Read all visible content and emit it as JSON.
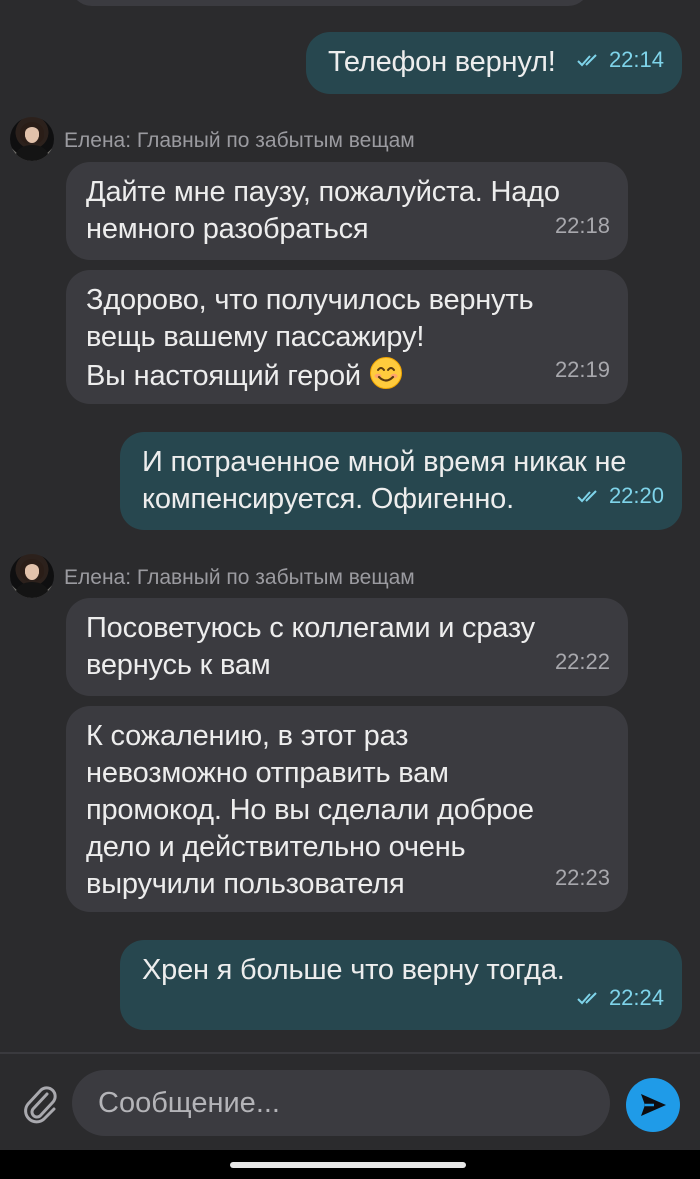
{
  "messages": [
    {
      "dir": "out",
      "text": "Телефон вернул!",
      "time": "22:14"
    },
    {
      "dir": "in",
      "sender": "Елена: Главный по забытым вещам",
      "text": "Дайте мне паузу, пожалуйста. Надо\nнемного разобраться",
      "time": "22:18"
    },
    {
      "dir": "in",
      "text": "Здорово, что получилось вернуть\nвещь вашему пассажиру!\nВы настоящий герой",
      "emoji": "smiling-face-icon",
      "time": "22:19"
    },
    {
      "dir": "out",
      "text": "И потраченное мной время никак не\nкомпенсируется. Офигенно.",
      "time": "22:20"
    },
    {
      "dir": "in",
      "sender": "Елена: Главный по забытым вещам",
      "text": "Посоветуюсь с коллегами и сразу\nвернусь к вам",
      "time": "22:22"
    },
    {
      "dir": "in",
      "text": "К сожалению, в этот раз\nневозможно отправить вам\nпромокод. Но вы сделали доброе\nдело и действительно очень\nвыручили пользователя",
      "time": "22:23"
    },
    {
      "dir": "out",
      "text": "Хрен я больше что верну тогда.",
      "time": "22:24"
    }
  ],
  "composer": {
    "placeholder": "Сообщение...",
    "attach_icon": "paperclip-icon",
    "send_icon": "send-icon"
  },
  "colors": {
    "background": "#2b2b2d",
    "incoming_bubble": "#3b3b40",
    "outgoing_bubble": "#27474f",
    "read_checks": "#7fd4ea",
    "send_button": "#1f9be8"
  }
}
